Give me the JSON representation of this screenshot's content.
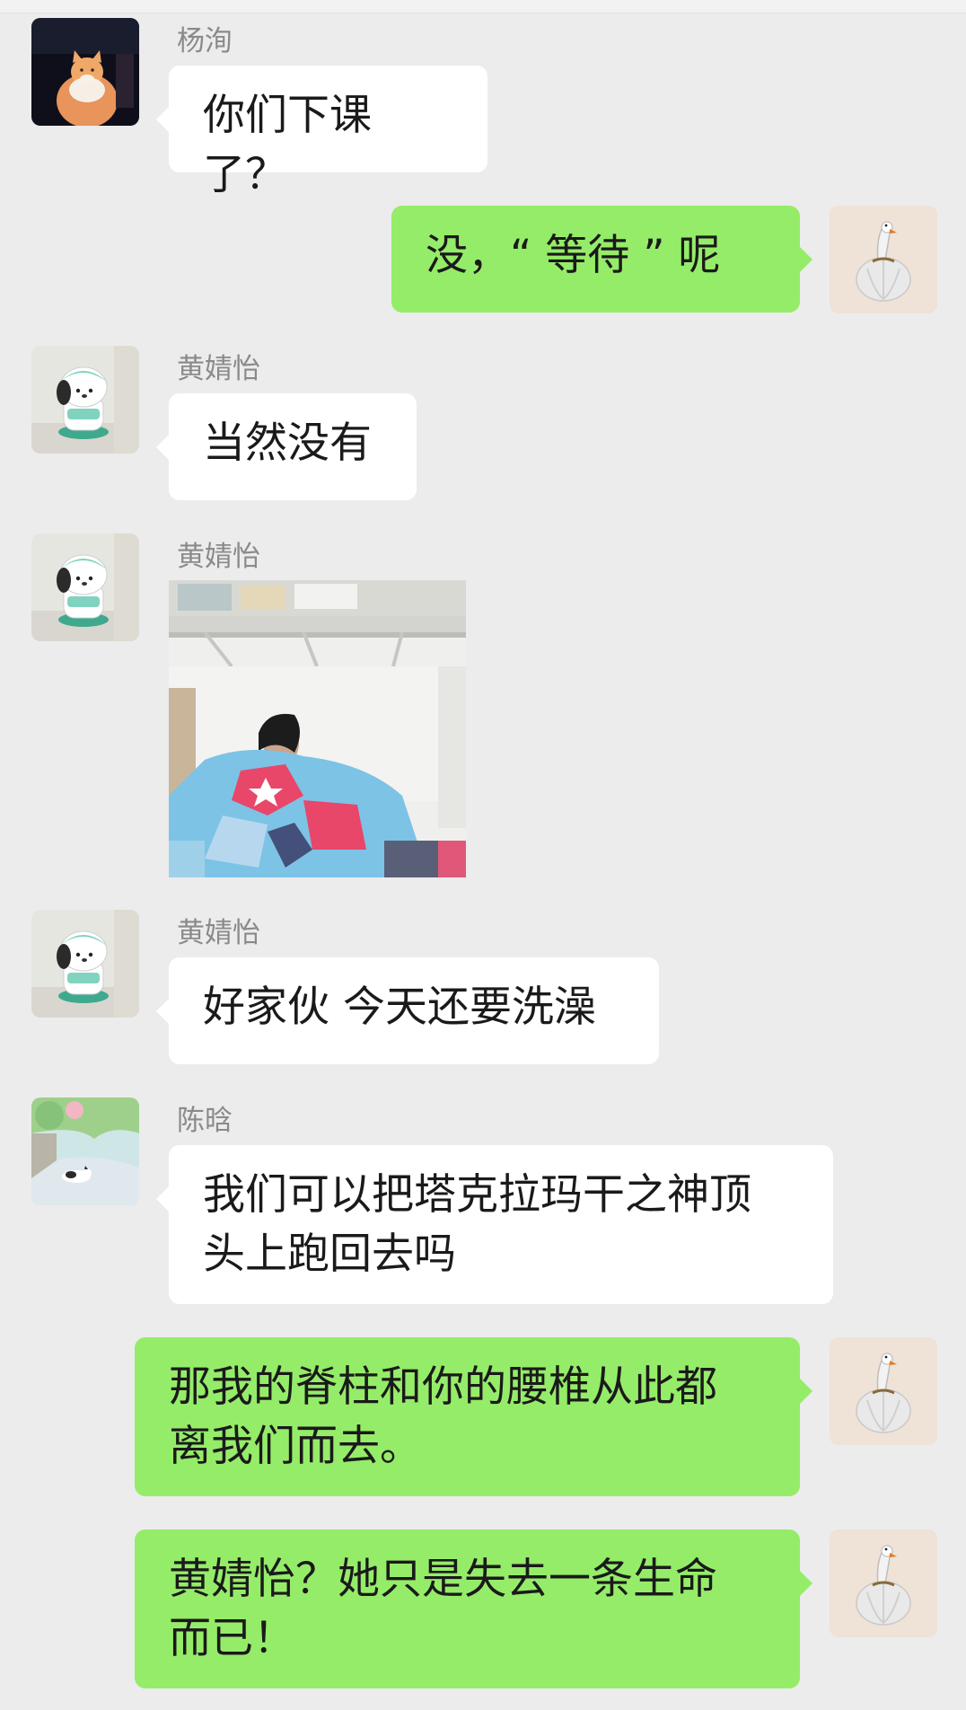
{
  "messages": [
    {
      "id": "m1",
      "side": "left",
      "sender": "杨洵",
      "avatar": "cat-avatar",
      "text": "你们下课了？"
    },
    {
      "id": "m2",
      "side": "right",
      "avatar": "garlic-avatar",
      "text": "没，“ 等待 ” 呢"
    },
    {
      "id": "m3",
      "side": "left",
      "sender": "黄婧怡",
      "avatar": "pochacco-avatar",
      "text": "当然没有"
    },
    {
      "id": "m4",
      "side": "left",
      "sender": "黄婧怡",
      "avatar": "pochacco-avatar",
      "type": "image",
      "image": "photo-girl-in-dorm-bed"
    },
    {
      "id": "m5",
      "side": "left",
      "sender": "黄婧怡",
      "avatar": "pochacco-avatar",
      "text": "好家伙 今天还要洗澡"
    },
    {
      "id": "m6",
      "side": "left",
      "sender": "陈晗",
      "avatar": "cat-painting-avatar",
      "line1": "我们可以把塔克拉玛干之神顶",
      "line2": "头上跑回去吗"
    },
    {
      "id": "m7",
      "side": "right",
      "avatar": "garlic-avatar",
      "line1": "那我的脊柱和你的腰椎从此都",
      "line2": "离我们而去。"
    },
    {
      "id": "m8",
      "side": "right",
      "avatar": "garlic-avatar",
      "line1": "黄婧怡？她只是失去一条生命",
      "line2": "而已！"
    }
  ],
  "colors": {
    "background": "#ececec",
    "bubble_self": "#95ec69",
    "bubble_other": "#ffffff",
    "sender_name": "#8a8a8a"
  }
}
